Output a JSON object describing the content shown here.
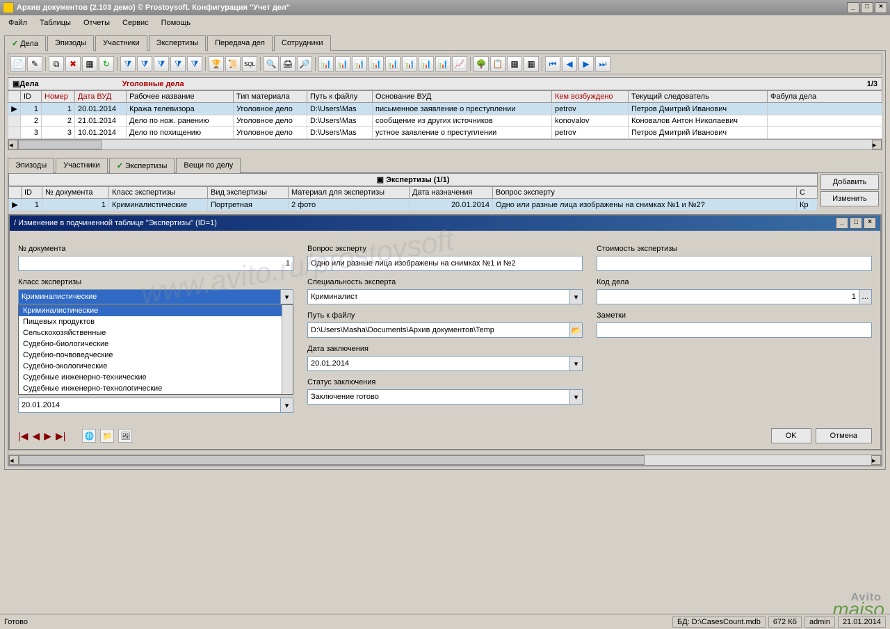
{
  "window_title": "Архив документов (2.103 демо) © Prostoysoft. Конфигурация \"Учет дел\"",
  "menu": [
    "Файл",
    "Таблицы",
    "Отчеты",
    "Сервис",
    "Помощь"
  ],
  "main_tabs": [
    "Дела",
    "Эпизоды",
    "Участники",
    "Экспертизы",
    "Передача дел",
    "Сотрудники"
  ],
  "grid_title": "Дела",
  "grid_category": "Уголовные дела",
  "pager": "1/3",
  "cols": [
    "ID",
    "Номер",
    "Дата ВУД",
    "Рабочее название",
    "Тип материала",
    "Путь к файлу",
    "Основание ВУД",
    "Кем возбуждено",
    "Текущий следователь",
    "Фабула дела"
  ],
  "rows": [
    {
      "id": "1",
      "num": "1",
      "date": "20.01.2014",
      "name": "Кража телевизора",
      "type": "Уголовное дело",
      "path": "D:\\Users\\Mas",
      "basis": "письменное заявление о преступлении",
      "who": "petrov",
      "inv": "Петров Дмитрий Иванович",
      "fab": ""
    },
    {
      "id": "2",
      "num": "2",
      "date": "21.01.2014",
      "name": "Дело по нож. ранению",
      "type": "Уголовное дело",
      "path": "D:\\Users\\Mas",
      "basis": "сообщение из других источников",
      "who": "konovalov",
      "inv": "Коновалов Антон Николаевич",
      "fab": ""
    },
    {
      "id": "3",
      "num": "3",
      "date": "10.01.2014",
      "name": "Дело по похищению",
      "type": "Уголовное дело",
      "path": "D:\\Users\\Mas",
      "basis": "устное заявление о преступлении",
      "who": "petrov",
      "inv": "Петров Дмитрий Иванович",
      "fab": ""
    }
  ],
  "sub_tabs": [
    "Эпизоды",
    "Участники",
    "Экспертизы",
    "Вещи по делу"
  ],
  "exp_header": "Экспертизы (1/1)",
  "btn_add": "Добавить",
  "btn_edit": "Изменить",
  "exp_cols": [
    "ID",
    "№ документа",
    "Класс экспертизы",
    "Вид экспертизы",
    "Материал для экспертизы",
    "Дата назначения",
    "Вопрос эксперту",
    "С"
  ],
  "exp_row": {
    "id": "1",
    "doc": "1",
    "klass": "Криминалистические",
    "kind": "Портретная",
    "mat": "2 фото",
    "date": "20.01.2014",
    "q": "Одно или разные лица изображены на снимках №1 и №2?",
    "s": "Кр"
  },
  "inner_title": "/ Изменение в подчиненной таблице \"Экспертизы\" (ID=1)",
  "form": {
    "doc_no_lbl": "№ документа",
    "doc_no": "1",
    "klass_lbl": "Класс экспертизы",
    "klass": "Криминалистические",
    "klass_options": [
      "Криминалистические",
      "Пищевых продуктов",
      "Сельскохозяйственные",
      "Судебно-биологические",
      "Судебно-почвоведческие",
      "Судебно-экологические",
      "Судебные инженерно-технические",
      "Судебные инженерно-технологические"
    ],
    "date2": "20.01.2014",
    "q_lbl": "Вопрос эксперту",
    "q": "Одно или разные лица изображены на снимках №1 и №2",
    "spec_lbl": "Специальность эксперта",
    "spec": "Криминалист",
    "path_lbl": "Путь к файлу",
    "path": "D:\\Users\\Masha\\Documents\\Архив документов\\Temp",
    "concl_date_lbl": "Дата заключения",
    "concl_date": "20.01.2014",
    "status_lbl": "Статус заключения",
    "status": "Заключение готово",
    "cost_lbl": "Стоимость экспертизы",
    "cost": "",
    "case_lbl": "Код дела",
    "case": "1",
    "notes_lbl": "Заметки",
    "notes": ""
  },
  "btn_ok": "OK",
  "btn_cancel": "Отмена",
  "status_text": "Готово",
  "status_db_lbl": "БД:",
  "status_db": "D:\\CasesCount.mdb",
  "status_size": "672 Кб",
  "status_u": "admin",
  "status_date": "21.01.2014",
  "watermark": "www.avito.ru/prostoysoft",
  "wm_avito": "Avito",
  "wm_bottom": "maiso"
}
